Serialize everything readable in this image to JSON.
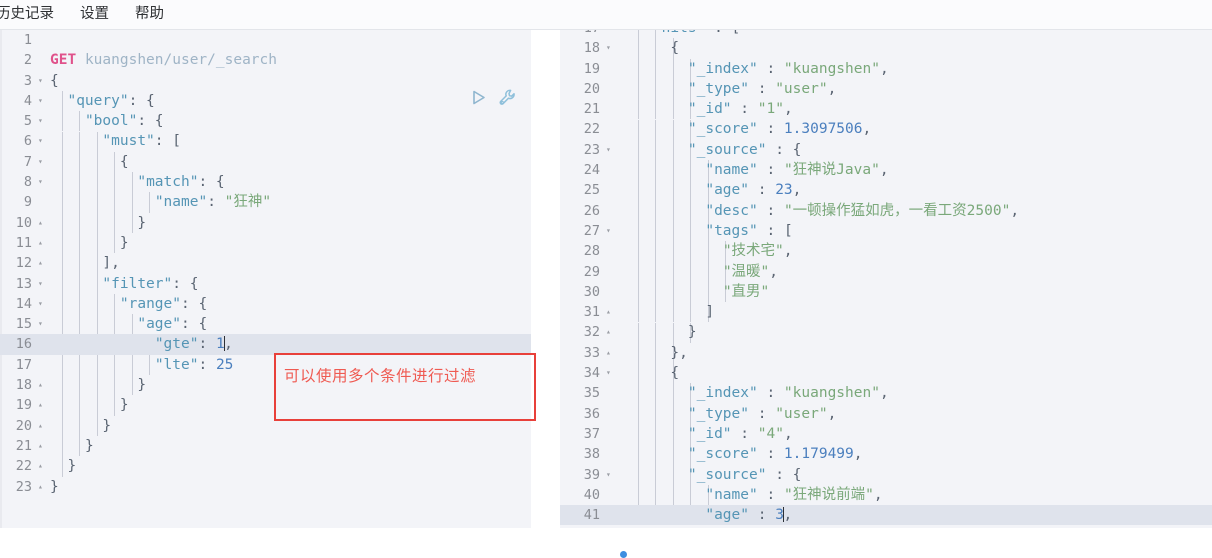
{
  "menu": {
    "items": [
      {
        "label": "历史记录",
        "name": "menu-history"
      },
      {
        "label": "设置",
        "name": "menu-settings"
      },
      {
        "label": "帮助",
        "name": "menu-help"
      }
    ]
  },
  "editor_actions": {
    "run": {
      "label": "运行",
      "icon": "play-icon"
    },
    "wrench": {
      "label": "工具",
      "icon": "wrench-icon"
    }
  },
  "annotation": {
    "text": "可以使用多个条件进行过滤",
    "color": "#ef5a52"
  },
  "request_editor": {
    "name": "request-editor",
    "active_line": 16,
    "lines": [
      {
        "n": 1,
        "fold": "",
        "text": ""
      },
      {
        "n": 2,
        "fold": "",
        "text": "GET kuangshen/user/_search"
      },
      {
        "n": 3,
        "fold": "open",
        "text": "{"
      },
      {
        "n": 4,
        "fold": "open",
        "text": "  \"query\": {"
      },
      {
        "n": 5,
        "fold": "open",
        "text": "    \"bool\": {"
      },
      {
        "n": 6,
        "fold": "open",
        "text": "      \"must\": ["
      },
      {
        "n": 7,
        "fold": "open",
        "text": "        {"
      },
      {
        "n": 8,
        "fold": "open",
        "text": "          \"match\": {"
      },
      {
        "n": 9,
        "fold": "",
        "text": "            \"name\": \"狂神\""
      },
      {
        "n": 10,
        "fold": "close",
        "text": "          }"
      },
      {
        "n": 11,
        "fold": "close",
        "text": "        }"
      },
      {
        "n": 12,
        "fold": "close",
        "text": "      ],"
      },
      {
        "n": 13,
        "fold": "open",
        "text": "      \"filter\": {"
      },
      {
        "n": 14,
        "fold": "open",
        "text": "        \"range\": {"
      },
      {
        "n": 15,
        "fold": "open",
        "text": "          \"age\": {"
      },
      {
        "n": 16,
        "fold": "",
        "text": "            \"gte\": 1,"
      },
      {
        "n": 17,
        "fold": "",
        "text": "            \"lte\": 25"
      },
      {
        "n": 18,
        "fold": "close",
        "text": "          }"
      },
      {
        "n": 19,
        "fold": "close",
        "text": "        }"
      },
      {
        "n": 20,
        "fold": "close",
        "text": "      }"
      },
      {
        "n": 21,
        "fold": "close",
        "text": "    }"
      },
      {
        "n": 22,
        "fold": "close",
        "text": "  }"
      },
      {
        "n": 23,
        "fold": "close",
        "text": "}"
      }
    ]
  },
  "response_editor": {
    "name": "response-editor",
    "active_line": 41,
    "lines": [
      {
        "n": 17,
        "fold": "open",
        "text": "    \"hits\" : [",
        "clipped": true
      },
      {
        "n": 18,
        "fold": "open",
        "text": "      {"
      },
      {
        "n": 19,
        "fold": "",
        "text": "        \"_index\" : \"kuangshen\","
      },
      {
        "n": 20,
        "fold": "",
        "text": "        \"_type\" : \"user\","
      },
      {
        "n": 21,
        "fold": "",
        "text": "        \"_id\" : \"1\","
      },
      {
        "n": 22,
        "fold": "",
        "text": "        \"_score\" : 1.3097506,"
      },
      {
        "n": 23,
        "fold": "open",
        "text": "        \"_source\" : {"
      },
      {
        "n": 24,
        "fold": "",
        "text": "          \"name\" : \"狂神说Java\","
      },
      {
        "n": 25,
        "fold": "",
        "text": "          \"age\" : 23,"
      },
      {
        "n": 26,
        "fold": "",
        "text": "          \"desc\" : \"一顿操作猛如虎，一看工资2500\","
      },
      {
        "n": 27,
        "fold": "open",
        "text": "          \"tags\" : ["
      },
      {
        "n": 28,
        "fold": "",
        "text": "            \"技术宅\","
      },
      {
        "n": 29,
        "fold": "",
        "text": "            \"温暖\","
      },
      {
        "n": 30,
        "fold": "",
        "text": "            \"直男\""
      },
      {
        "n": 31,
        "fold": "close",
        "text": "          ]"
      },
      {
        "n": 32,
        "fold": "close",
        "text": "        }"
      },
      {
        "n": 33,
        "fold": "close",
        "text": "      },"
      },
      {
        "n": 34,
        "fold": "open",
        "text": "      {"
      },
      {
        "n": 35,
        "fold": "",
        "text": "        \"_index\" : \"kuangshen\","
      },
      {
        "n": 36,
        "fold": "",
        "text": "        \"_type\" : \"user\","
      },
      {
        "n": 37,
        "fold": "",
        "text": "        \"_id\" : \"4\","
      },
      {
        "n": 38,
        "fold": "",
        "text": "        \"_score\" : 1.179499,"
      },
      {
        "n": 39,
        "fold": "open",
        "text": "        \"_source\" : {"
      },
      {
        "n": 40,
        "fold": "",
        "text": "          \"name\" : \"狂神说前端\","
      },
      {
        "n": 41,
        "fold": "",
        "text": "          \"age\" : 3,"
      }
    ]
  }
}
